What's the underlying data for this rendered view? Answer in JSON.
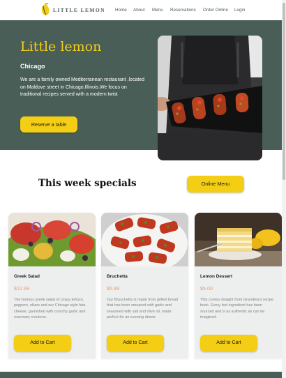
{
  "brand": {
    "name": "LITTLE LEMON",
    "icon": "lemon-icon"
  },
  "nav": {
    "items": [
      {
        "label": "Home"
      },
      {
        "label": "About"
      },
      {
        "label": "Menu"
      },
      {
        "label": "Reservations"
      },
      {
        "label": "Order Online"
      },
      {
        "label": "Login"
      }
    ]
  },
  "hero": {
    "title": "Little lemon",
    "city": "Chicago",
    "description": "We are a family owned Mediterranean restaurant ,located on Maldove street in Chicago,Illinois.We focus on traditional recipes served with a modern twist",
    "cta": "Reserve a table",
    "image": "chef-holding-bruschetta-platter"
  },
  "specials": {
    "title": "This week specials",
    "online_menu": "Online Menu",
    "cards": [
      {
        "name": "Greek Salad",
        "price": "$12.99",
        "description": "The famous greek salad of crispy lettuce, peppers, olives and our Chicago style feta cheese, garnished with crunchy garlic and rosemary croutons.",
        "button": "Add to Cart",
        "image": "greek-salad"
      },
      {
        "name": "Bruchetta",
        "price": "$5.99",
        "description": "Our Bruschetta is made from grilled bread that has been smeared with garlic and seasoned with salt and olive oil, made perfect for an evening dinner.",
        "button": "Add to Cart",
        "image": "bruschetta-plate"
      },
      {
        "name": "Lemon Dessert",
        "price": "$5.00",
        "description": "This comes straight from Grandma's recipe book. Every last ingredient has been sourced and is as authentic as can be imagined.",
        "button": "Add to Cart",
        "image": "lemon-cake"
      }
    ]
  },
  "colors": {
    "primary_green": "#495e57",
    "primary_yellow": "#f4ce14",
    "price_orange": "#ee9972",
    "card_bg": "#edefee"
  }
}
